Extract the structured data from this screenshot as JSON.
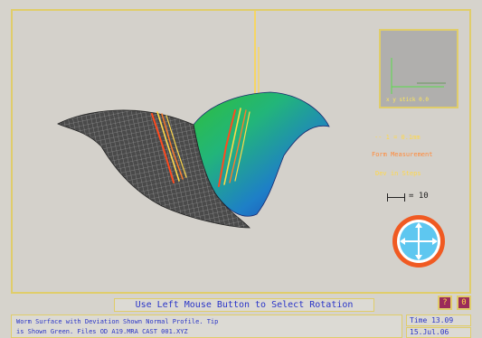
{
  "viewport": {
    "preview": {
      "label": "x y stick  0.0"
    },
    "info": {
      "line1": "-- 1 = 0.1mm",
      "line2": "Form Measurement",
      "line3": "Dev in Steps"
    },
    "scale": {
      "label": "= 10"
    },
    "rotator_icon": "rotate-arrows-icon"
  },
  "status": {
    "hint": "Use Left Mouse Button to Select Rotation",
    "help_button_label": "?",
    "exit_button_label": "0",
    "description_line1": "Worm Surface with Deviation Shown Normal Profile. Tip",
    "description_line2": "is Shown Green. Files OD A19.MRA CAST 001.XYZ",
    "time": "Time 13.09",
    "date": "15.Jul.06"
  },
  "colors": {
    "frame_border": "#e0cd6a",
    "text_blue": "#2a35c8",
    "accent_orange": "#f05a22",
    "rotator_blue": "#5ec7f0"
  }
}
